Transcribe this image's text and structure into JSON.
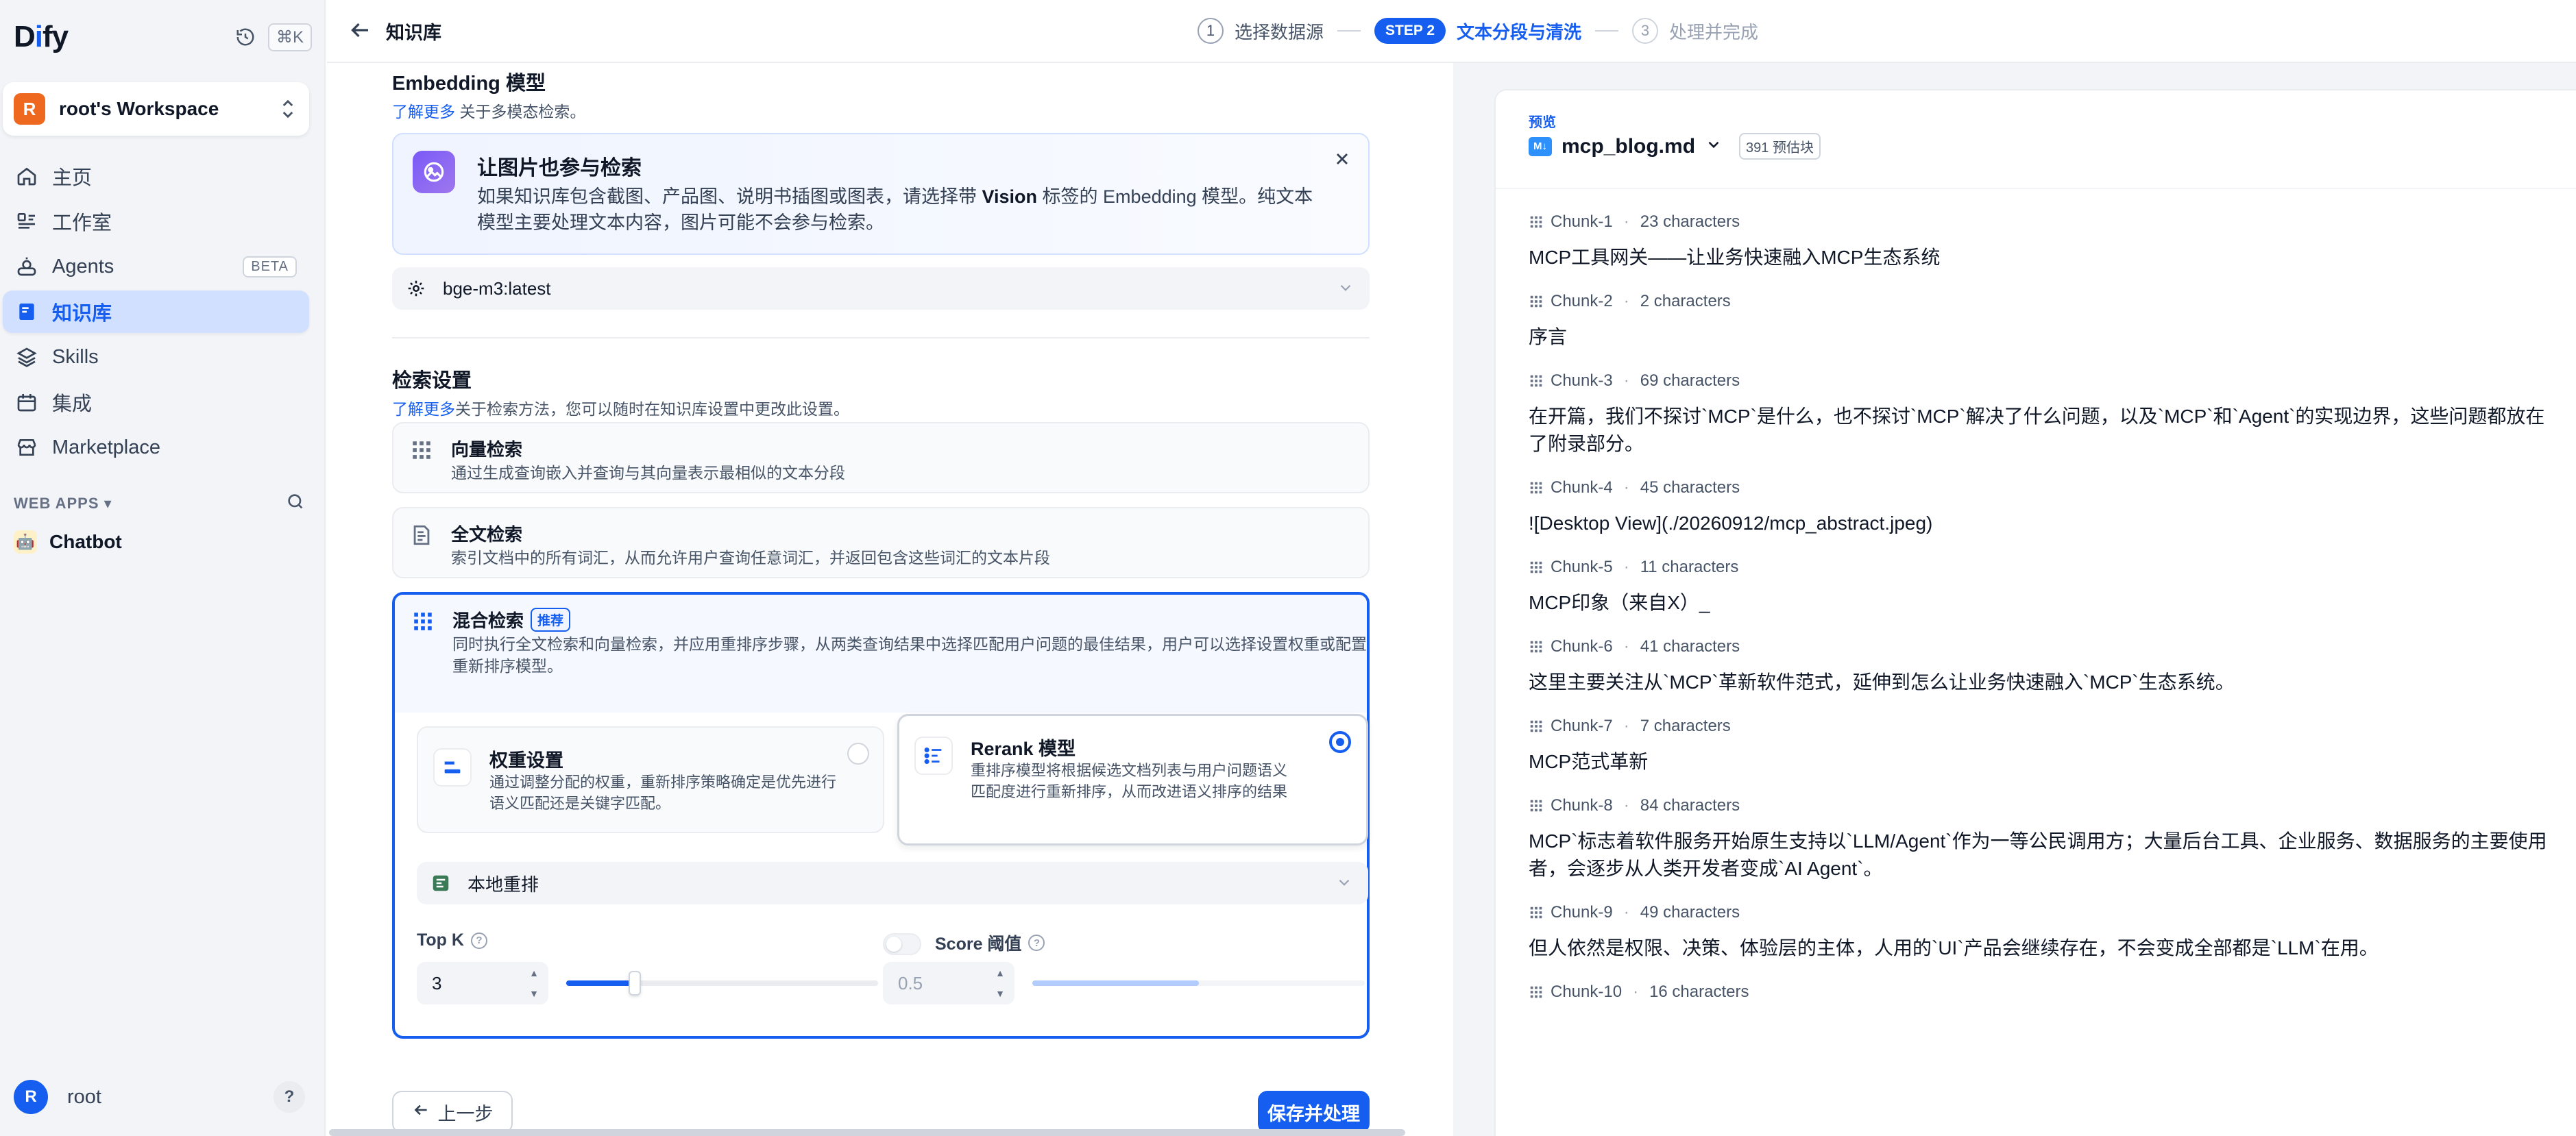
{
  "sidebar": {
    "logo": "Dify",
    "shortcut": "⌘K",
    "workspace": {
      "avatar": "R",
      "name": "root's Workspace"
    },
    "nav": [
      {
        "label": "主页",
        "icon": "home-icon"
      },
      {
        "label": "工作室",
        "icon": "studio-icon"
      },
      {
        "label": "Agents",
        "icon": "agents-icon",
        "badge": "BETA"
      },
      {
        "label": "知识库",
        "icon": "knowledge-icon",
        "active": true
      },
      {
        "label": "Skills",
        "icon": "skills-icon"
      },
      {
        "label": "集成",
        "icon": "integration-icon"
      },
      {
        "label": "Marketplace",
        "icon": "marketplace-icon"
      }
    ],
    "webapps_label": "WEB APPS",
    "apps": [
      {
        "label": "Chatbot",
        "icon": "chatbot-icon"
      }
    ],
    "user": {
      "avatar": "R",
      "name": "root",
      "help": "?"
    }
  },
  "topbar": {
    "breadcrumb": "知识库",
    "steps": [
      {
        "num": "1",
        "label": "选择数据源",
        "state": "done"
      },
      {
        "num": "STEP 2",
        "label": "文本分段与清洗",
        "state": "active"
      },
      {
        "num": "3",
        "label": "处理并完成",
        "state": "pending"
      }
    ]
  },
  "embedding": {
    "title": "Embedding 模型",
    "learn_more": "了解更多",
    "subtitle": "关于多模态检索。",
    "vision_card": {
      "title": "让图片也参与检索",
      "text_before": "如果知识库包含截图、产品图、说明书插图或图表，请选择带 ",
      "text_bold": "Vision",
      "text_after": " 标签的 Embedding 模型。纯文本模型主要处理文本内容，图片可能不会参与检索。"
    },
    "model_value": "bge-m3:latest"
  },
  "retrieval": {
    "title": "检索设置",
    "learn_more": "了解更多",
    "subtitle": "关于检索方法，您可以随时在知识库设置中更改此设置。",
    "vector": {
      "title": "向量检索",
      "desc": "通过生成查询嵌入并查询与其向量表示最相似的文本分段"
    },
    "fulltext": {
      "title": "全文检索",
      "desc": "索引文档中的所有词汇，从而允许用户查询任意词汇，并返回包含这些词汇的文本片段"
    },
    "hybrid": {
      "title": "混合检索",
      "badge": "推荐",
      "desc": "同时执行全文检索和向量检索，并应用重排序步骤，从两类查询结果中选择匹配用户问题的最佳结果，用户可以选择设置权重或配置重新排序模型。",
      "weight": {
        "title": "权重设置",
        "desc": "通过调整分配的权重，重新排序策略确定是优先进行语义匹配还是关键字匹配。"
      },
      "rerank": {
        "title": "Rerank 模型",
        "desc": "重排序模型将根据候选文档列表与用户问题语义匹配度进行重新排序，从而改进语义排序的结果"
      },
      "rerank_model": "本地重排",
      "top_k": {
        "label": "Top K",
        "value": "3",
        "fraction": 0.22
      },
      "score": {
        "label": "Score 阈值",
        "value": "0.5",
        "fraction": 0.5
      }
    }
  },
  "actions": {
    "prev": "上一步",
    "save": "保存并处理"
  },
  "preview": {
    "label": "预览",
    "file_badge": "M↓",
    "filename": "mcp_blog.md",
    "count": "391 预估块",
    "chunks": [
      {
        "name": "Chunk-1",
        "chars": "23 characters",
        "text": "MCP工具网关——让业务快速融入MCP生态系统"
      },
      {
        "name": "Chunk-2",
        "chars": "2 characters",
        "text": "序言"
      },
      {
        "name": "Chunk-3",
        "chars": "69 characters",
        "text": "在开篇，我们不探讨`MCP`是什么，也不探讨`MCP`解决了什么问题，以及`MCP`和`Agent`的实现边界，这些问题都放在了附录部分。"
      },
      {
        "name": "Chunk-4",
        "chars": "45 characters",
        "text": "![Desktop View](./20260912/mcp_abstract.jpeg)"
      },
      {
        "name": "Chunk-5",
        "chars": "11 characters",
        "text": "MCP印象（来自X）_"
      },
      {
        "name": "Chunk-6",
        "chars": "41 characters",
        "text": "这里主要关注从`MCP`革新软件范式，延伸到怎么让业务快速融入`MCP`生态系统。"
      },
      {
        "name": "Chunk-7",
        "chars": "7 characters",
        "text": "MCP范式革新"
      },
      {
        "name": "Chunk-8",
        "chars": "84 characters",
        "text": "MCP`标志着软件服务开始原生支持以`LLM/Agent`作为一等公民调用方；大量后台工具、企业服务、数据服务的主要使用者，会逐步从人类开发者变成`AI Agent`。"
      },
      {
        "name": "Chunk-9",
        "chars": "49 characters",
        "text": "但人依然是权限、决策、体验层的主体，人用的`UI`产品会继续存在，不会变成全部都是`LLM`在用。"
      },
      {
        "name": "Chunk-10",
        "chars": "16 characters",
        "text": ""
      }
    ]
  },
  "colors": {
    "accent": "#155eef",
    "sidebar_bg": "#f2f4f7",
    "workspace_avatar": "#ef6820"
  }
}
